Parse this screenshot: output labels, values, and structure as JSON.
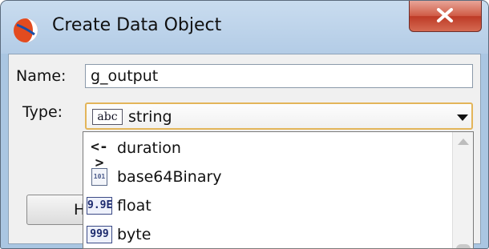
{
  "window": {
    "title": "Create Data Object"
  },
  "form": {
    "name_label": "Name:",
    "name_value": "g_output",
    "type_label": "Type:",
    "type_selected": "string",
    "type_icon_text": "abc"
  },
  "help_button_label": "Help",
  "type_options": [
    {
      "label": "duration",
      "icon": "duration-icon",
      "icon_text": "<->"
    },
    {
      "label": "base64Binary",
      "icon": "binary-document-icon",
      "icon_text": "101"
    },
    {
      "label": "float",
      "icon": "float-number-icon",
      "icon_text": "9.9E"
    },
    {
      "label": "byte",
      "icon": "byte-number-icon",
      "icon_text": "999"
    }
  ],
  "colors": {
    "title_bg": "#b3cce6",
    "close_red": "#cf5a45",
    "select_focus": "#e3b55a"
  }
}
